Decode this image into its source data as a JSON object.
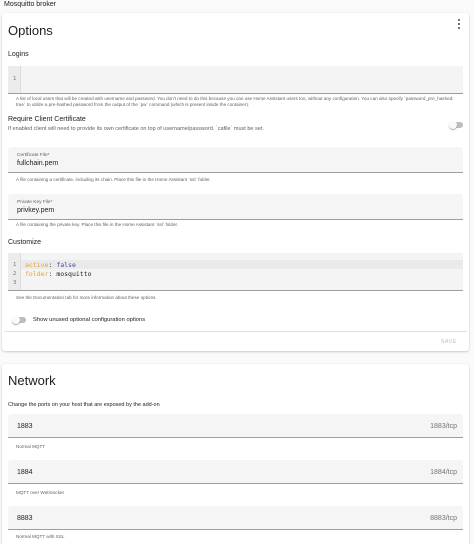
{
  "header": {
    "title": "Mosquitto broker"
  },
  "options": {
    "title": "Options",
    "logins": {
      "label": "Logins",
      "line_number": "1",
      "helper": "A list of local users that will be created with username and password. You don't need to do this because you can use Home Assistant users too, without any configuration. You can also specify `password_pre_hashed: true` to utilize a pre-hashed password from the output of the `pw` command (which is present inside the container)."
    },
    "require_cert": {
      "label": "Require Client Certificate",
      "description": "If enabled client will need to provide its own certificate on top of username/password. `cafile` must be set.",
      "enabled": false
    },
    "certfile": {
      "label": "Certificate File*",
      "value": "fullchain.pem",
      "helper": "A file containing a certificate, including its chain. Place this file in the Home Assistant `ssl` folder."
    },
    "keyfile": {
      "label": "Private Key File*",
      "value": "privkey.pem",
      "helper": "A file containing the private key. Place this file in the Home Assistant `ssl` folder."
    },
    "customize": {
      "label": "Customize",
      "lines": [
        {
          "num": "1",
          "key": "active",
          "value": "false"
        },
        {
          "num": "2",
          "key": "folder",
          "value": "mosquitto"
        },
        {
          "num": "3",
          "key": "",
          "value": ""
        }
      ],
      "helper": "See the Documentation tab for more information about these options."
    },
    "show_unused": {
      "label": "Show unused optional configuration options",
      "enabled": false
    },
    "save_label": "SAVE"
  },
  "network": {
    "title": "Network",
    "description": "Change the ports on your host that are exposed by the add-on",
    "ports": [
      {
        "value": "1883",
        "suffix": "1883/tcp",
        "helper": "Normal MQTT"
      },
      {
        "value": "1884",
        "suffix": "1884/tcp",
        "helper": "MQTT over WebSocket"
      },
      {
        "value": "8883",
        "suffix": "8883/tcp",
        "helper": "Normal MQTT with SSL"
      }
    ]
  }
}
